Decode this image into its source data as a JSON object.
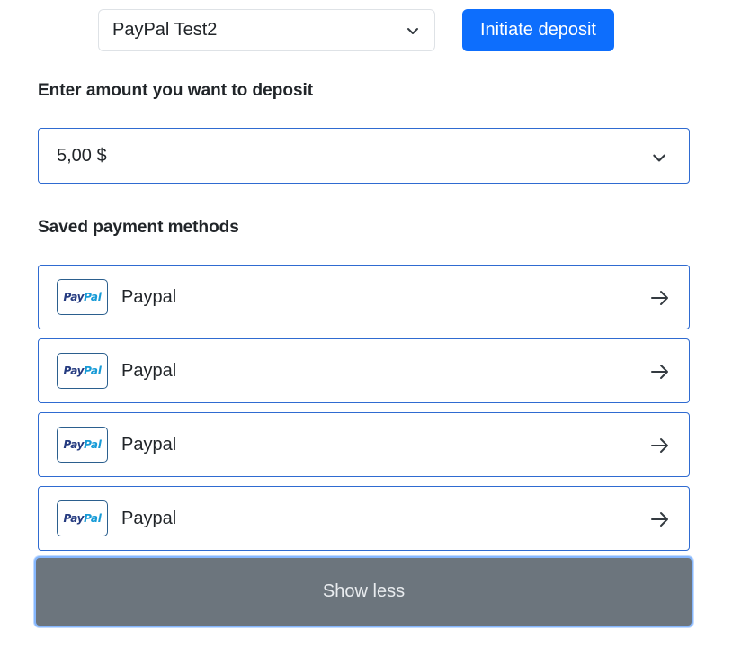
{
  "account_select": {
    "value": "PayPal Test2",
    "icon": "chevron-down-icon"
  },
  "initiate_button": {
    "label": "Initiate deposit",
    "color": "#0d6efd"
  },
  "amount_section": {
    "label": "Enter amount you want to deposit",
    "select_value": "5,00 $",
    "icon": "chevron-down-icon"
  },
  "saved_methods": {
    "label": "Saved payment methods",
    "items": [
      {
        "logo_pay": "Pay",
        "logo_pal": "Pal",
        "name": "Paypal",
        "icon": "arrow-right-icon"
      },
      {
        "logo_pay": "Pay",
        "logo_pal": "Pal",
        "name": "Paypal",
        "icon": "arrow-right-icon"
      },
      {
        "logo_pay": "Pay",
        "logo_pal": "Pal",
        "name": "Paypal",
        "icon": "arrow-right-icon"
      },
      {
        "logo_pay": "Pay",
        "logo_pal": "Pal",
        "name": "Paypal",
        "icon": "arrow-right-icon"
      }
    ]
  },
  "show_less_button": {
    "label": "Show less",
    "color": "#6c757d"
  }
}
